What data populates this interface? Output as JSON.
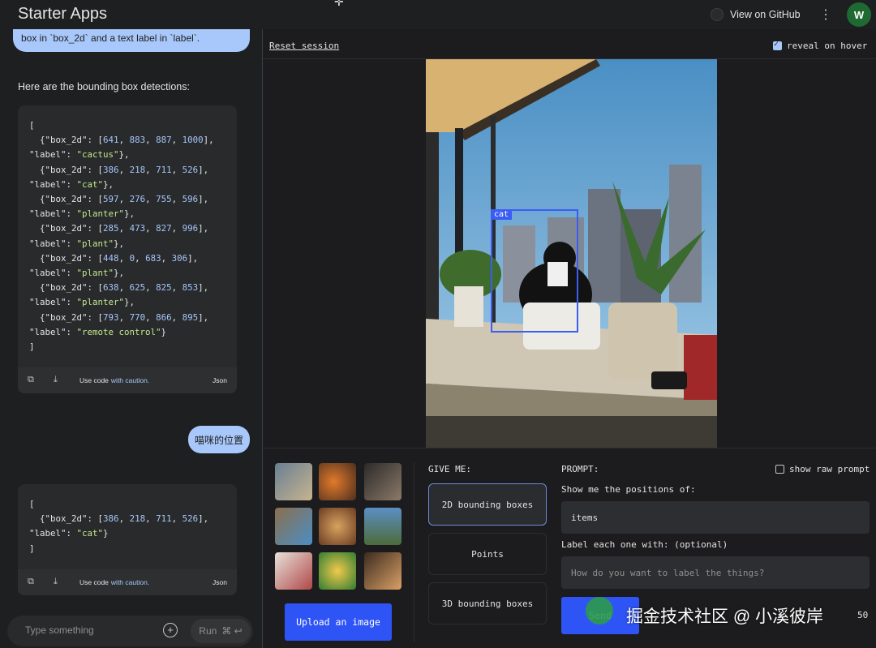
{
  "header": {
    "app_title": "Starter Apps",
    "github_label": "View on GitHub",
    "avatar_initial": "W"
  },
  "chat": {
    "prev_message_fragment": "box in `box_2d` and a text label in `label`.",
    "response_intro": "Here are the bounding box detections:",
    "code_block_1": [
      "[",
      "  {\"box_2d\": [641, 883, 887, 1000],",
      "\"label\": \"cactus\"},",
      "  {\"box_2d\": [386, 218, 711, 526],",
      "\"label\": \"cat\"},",
      "  {\"box_2d\": [597, 276, 755, 596],",
      "\"label\": \"planter\"},",
      "  {\"box_2d\": [285, 473, 827, 996],",
      "\"label\": \"plant\"},",
      "  {\"box_2d\": [448, 0, 683, 306],",
      "\"label\": \"plant\"},",
      "  {\"box_2d\": [638, 625, 825, 853],",
      "\"label\": \"planter\"},",
      "  {\"box_2d\": [793, 770, 866, 895],",
      "\"label\": \"remote control\"}",
      "]"
    ],
    "code_block_2": [
      "[",
      "  {\"box_2d\": [386, 218, 711, 526],",
      "\"label\": \"cat\"}",
      "]"
    ],
    "code_footer": {
      "use_code": "Use code",
      "caution_link": "with caution.",
      "language": "Json"
    },
    "user_message": "喵咪的位置",
    "input_placeholder": "Type something",
    "run_label": "Run",
    "run_shortcut": "⌘ ↩"
  },
  "main": {
    "reset_label": "Reset session",
    "reveal_label": "reveal on hover",
    "reveal_checked": true,
    "detection_label": "cat",
    "give_me_label": "GIVE ME:",
    "options": [
      {
        "label": "2D bounding boxes",
        "selected": true
      },
      {
        "label": "Points",
        "selected": false
      },
      {
        "label": "3D bounding boxes",
        "selected": false
      }
    ],
    "prompt_label": "PROMPT:",
    "show_raw_label": "show raw prompt",
    "show_raw_checked": false,
    "show_positions_label": "Show me the positions of:",
    "items_value": "items",
    "label_with_label": "Label each one with: (optional)",
    "label_placeholder": "How do you want to label the things?",
    "send_label": "Send",
    "temperature_value": "50",
    "upload_label": "Upload an image"
  },
  "watermark": {
    "text": "掘金技术社区 @ 小溪彼岸"
  },
  "colors": {
    "accent_blue": "#2f54f6",
    "bubble": "#a8c7fa",
    "bbox": "#3b5cf5"
  }
}
